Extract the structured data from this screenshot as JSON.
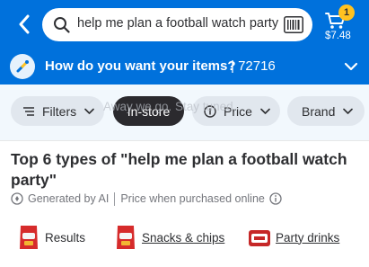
{
  "header": {
    "search_query": "help me plan a football watch party",
    "cart_count": "1",
    "cart_total": "$7.48"
  },
  "delivery": {
    "question": "How do you want your items?",
    "zip": "| 72716"
  },
  "filters": {
    "filters_label": "Filters",
    "instore_label": "In-store",
    "price_label": "Price",
    "brand_label": "Brand",
    "ghost_text": "Away we go. Stay tuned."
  },
  "results": {
    "title": "Top 6 types of \"help me plan a football watch party\"",
    "generated_by": "Generated by AI",
    "price_note": "Price when purchased online"
  },
  "categories": [
    {
      "label": "Results"
    },
    {
      "label": "Snacks & chips"
    },
    {
      "label": "Party drinks"
    }
  ],
  "colors": {
    "brand_blue": "#0071dc",
    "spark_yellow": "#ffc220",
    "selected_pill": "#2b2a2e"
  },
  "icons": [
    "back-arrow-icon",
    "search-icon",
    "barcode-icon",
    "cart-icon",
    "delivery-icon",
    "chevron-down-icon",
    "filter-sliders-icon",
    "price-tag-icon",
    "ai-sparkle-icon",
    "info-icon"
  ]
}
